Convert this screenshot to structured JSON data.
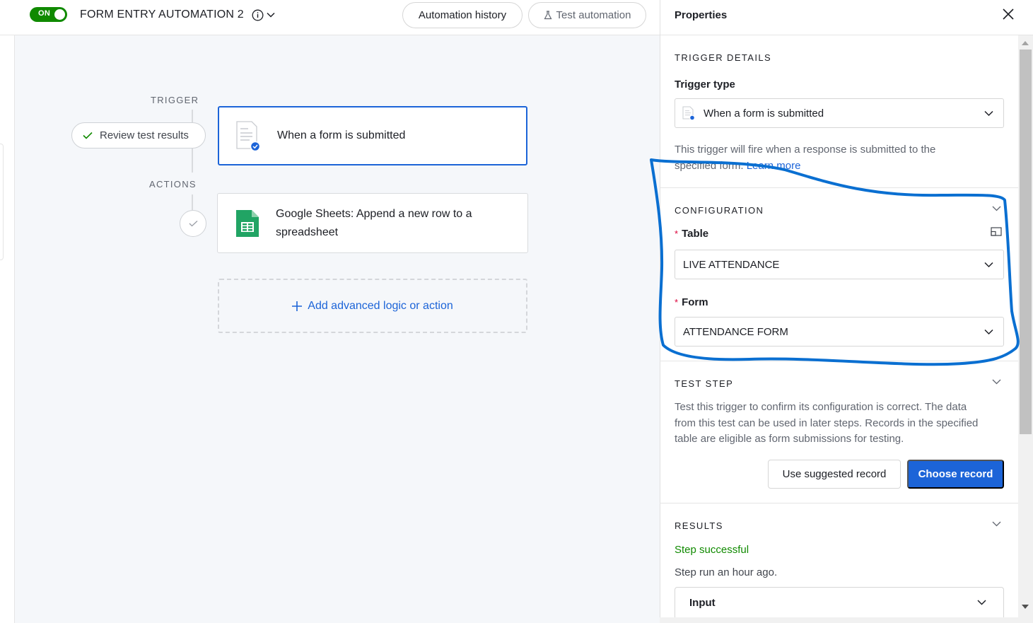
{
  "header": {
    "toggle_label": "ON",
    "automation_title": "FORM ENTRY AUTOMATION 2",
    "history_button": "Automation history",
    "test_button": "Test automation"
  },
  "canvas": {
    "trigger_label": "TRIGGER",
    "actions_label": "ACTIONS",
    "review_button": "Review test results",
    "trigger_card": "When a form is submitted",
    "action_card_line1": "Google Sheets: Append a new row to a",
    "action_card_line2": "spreadsheet",
    "add_action": "Add advanced logic or action"
  },
  "panel": {
    "title": "Properties",
    "trigger_details": {
      "heading": "TRIGGER DETAILS",
      "type_label": "Trigger type",
      "type_value": "When a form is submitted",
      "description_line1": "This trigger will fire when a response is submitted to the",
      "description_line2": "specified form.",
      "learn_more": "Learn more"
    },
    "configuration": {
      "heading": "CONFIGURATION",
      "table_label": "Table",
      "table_value": "LIVE ATTENDANCE",
      "form_label": "Form",
      "form_value": "ATTENDANCE FORM",
      "required_mark": "*"
    },
    "test_step": {
      "heading": "TEST STEP",
      "line1": "Test this trigger to confirm its configuration is correct. The data",
      "line2": "from this test can be used in later steps. Records in the specified",
      "line3": "table are eligible as form submissions for testing.",
      "suggested_button": "Use suggested record",
      "choose_button": "Choose record"
    },
    "results": {
      "heading": "RESULTS",
      "status": "Step successful",
      "run_time": "Step run an hour ago.",
      "input_label": "Input"
    }
  },
  "colors": {
    "accent": "#1c64d8",
    "toggle_on": "#108a00",
    "success": "#108a00",
    "annotation": "#0a6fd1",
    "sheets_green": "#21a464"
  }
}
